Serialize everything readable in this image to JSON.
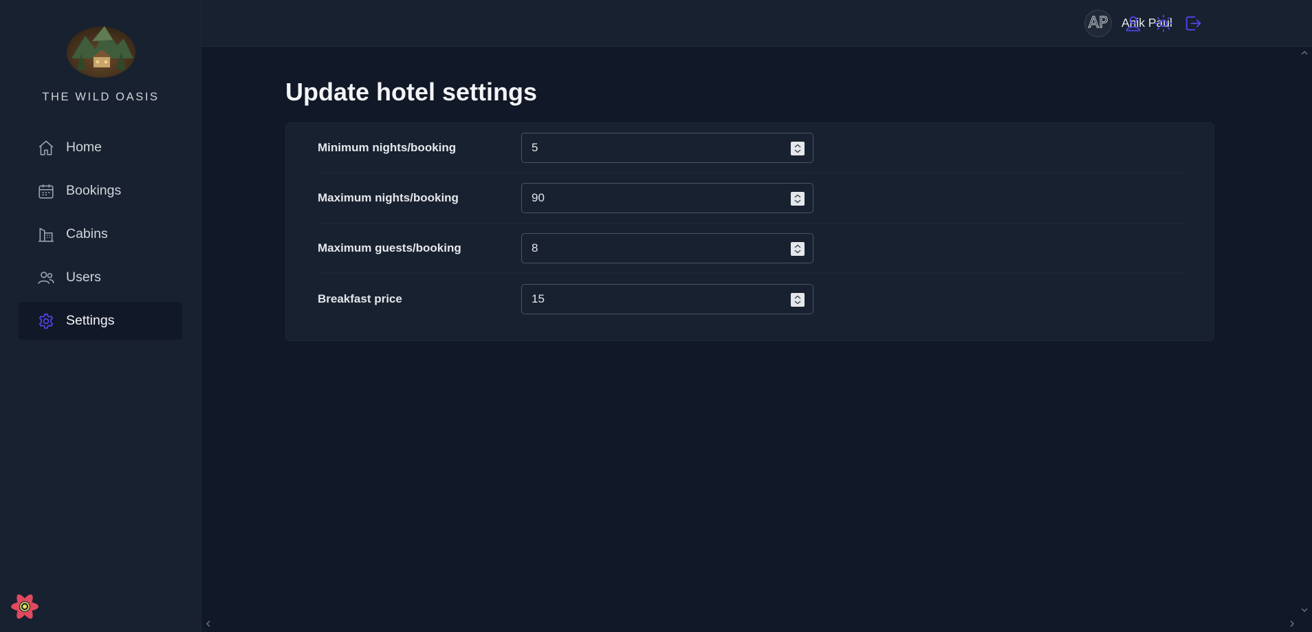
{
  "brand": {
    "name": "THE WILD OASIS"
  },
  "sidebar": {
    "items": [
      {
        "label": "Home",
        "icon": "home-icon"
      },
      {
        "label": "Bookings",
        "icon": "calendar-icon"
      },
      {
        "label": "Cabins",
        "icon": "building-icon"
      },
      {
        "label": "Users",
        "icon": "users-icon"
      },
      {
        "label": "Settings",
        "icon": "gear-icon",
        "active": true
      }
    ]
  },
  "header": {
    "avatar_initials": "AP",
    "user_name": "Anik Paul",
    "buttons": [
      "user-icon",
      "sun-icon",
      "logout-icon"
    ]
  },
  "main": {
    "title": "Update hotel settings",
    "fields": [
      {
        "label": "Minimum nights/booking",
        "value": "5"
      },
      {
        "label": "Maximum nights/booking",
        "value": "90"
      },
      {
        "label": "Maximum guests/booking",
        "value": "8"
      },
      {
        "label": "Breakfast price",
        "value": "15"
      }
    ]
  },
  "colors": {
    "accent": "#4f46e5",
    "background": "#111827",
    "panel": "#18212f",
    "border": "#1f2937"
  }
}
